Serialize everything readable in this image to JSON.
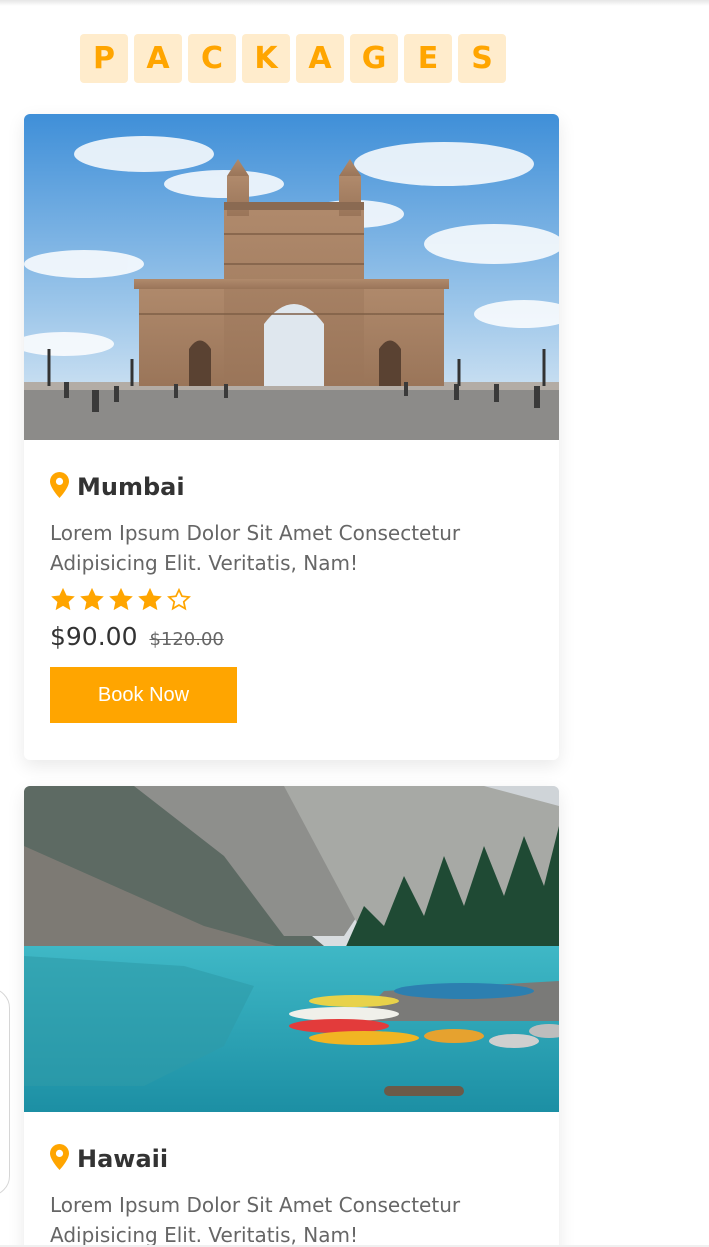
{
  "section": {
    "heading_letters": [
      "P",
      "A",
      "C",
      "K",
      "A",
      "G",
      "E",
      "S"
    ]
  },
  "packages": [
    {
      "location": "Mumbai",
      "description": "Lorem Ipsum Dolor Sit Amet Consectetur Adipisicing Elit. Veritatis, Nam!",
      "rating": 4,
      "rating_max": 5,
      "price": "$90.00",
      "old_price": "$120.00",
      "button_label": "Book Now",
      "image_icon": "gateway-of-india-photo"
    },
    {
      "location": "Hawaii",
      "description": "Lorem Ipsum Dolor Sit Amet Consectetur Adipisicing Elit. Veritatis, Nam!",
      "image_icon": "mountain-lake-photo"
    }
  ],
  "colors": {
    "accent": "#ffa500",
    "accent_light": "#ffeccc",
    "text": "#333333",
    "muted": "#666666"
  },
  "icons": {
    "location": "map-marker-icon",
    "star_filled": "star-filled-icon",
    "star_empty": "star-outline-icon"
  }
}
